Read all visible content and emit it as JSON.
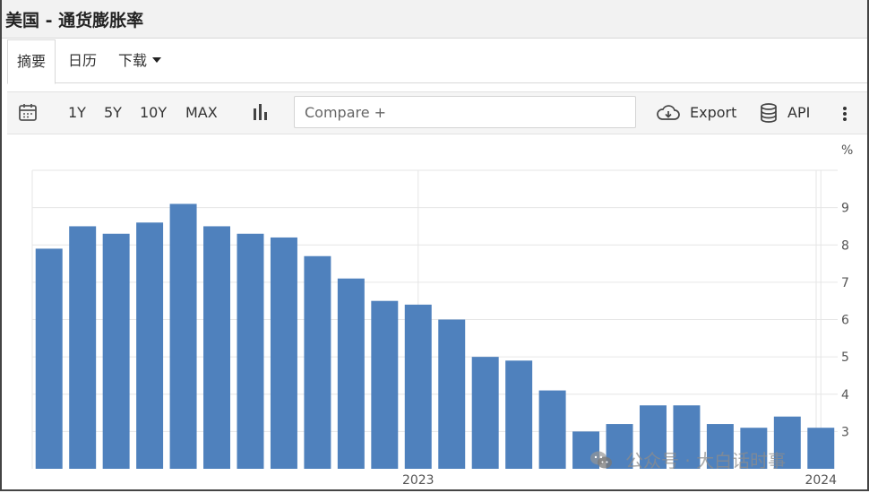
{
  "window": {
    "title": "美国 - 通货膨胀率"
  },
  "tabs": [
    {
      "label": "摘要"
    },
    {
      "label": "日历"
    },
    {
      "label": "下载"
    }
  ],
  "toolbar": {
    "ranges": [
      "1Y",
      "5Y",
      "10Y",
      "MAX"
    ],
    "compare_placeholder": "Compare +",
    "export_label": "Export",
    "api_label": "API",
    "icons": {
      "calendar": "calendar-icon",
      "chart_type": "bar-chart-icon",
      "export": "cloud-download-icon",
      "api": "database-icon",
      "more": "more-vertical-icon"
    }
  },
  "watermark": {
    "text": "公众号 · 大白话时事"
  },
  "colors": {
    "bar": "#4f81bd",
    "grid": "#e6e6e6"
  },
  "chart_data": {
    "type": "bar",
    "unit_label": "%",
    "values": [
      7.9,
      8.5,
      8.3,
      8.6,
      9.1,
      8.5,
      8.3,
      8.2,
      7.7,
      7.1,
      6.5,
      6.4,
      6.0,
      5.0,
      4.9,
      4.1,
      3.0,
      3.2,
      3.7,
      3.7,
      3.2,
      3.1,
      3.4,
      3.1
    ],
    "x_tick_labels": [
      {
        "label": "2023",
        "index": 11
      },
      {
        "label": "2024",
        "index": 23
      }
    ],
    "y_ticks": [
      3,
      4,
      5,
      6,
      7,
      8,
      9
    ],
    "ylim": [
      2.0,
      10.0
    ],
    "y_axis_position": "right",
    "grid": true
  }
}
